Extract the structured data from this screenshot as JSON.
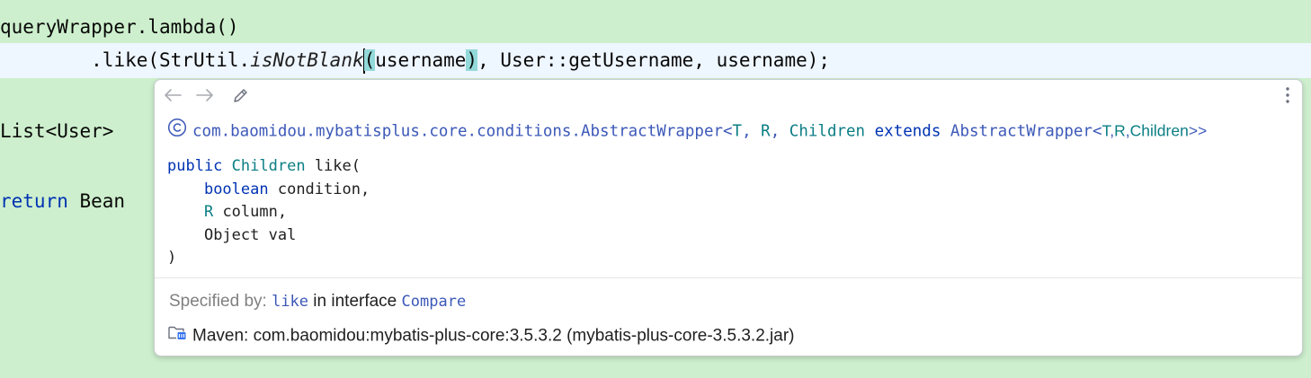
{
  "editor": {
    "line1": "queryWrapper.lambda()",
    "line2": {
      "indent": "        ",
      "like_call": ".like(StrUtil.",
      "method": "isNotBlank",
      "open_paren": "(",
      "arg": "username",
      "close_paren": ")",
      "rest": ", User::getUsername, username);"
    },
    "line3": "List<User>",
    "line4": {
      "keyword": "return",
      "rest": " Bean"
    }
  },
  "popup": {
    "header": {
      "class_path": "com.baomidou.mybatisplus.core.conditions.AbstractWrapper<",
      "t1": "T",
      "sep1": ", ",
      "t2": "R",
      "sep2": ", ",
      "t3": "Children",
      "extends_kw": " extends ",
      "super_class": "AbstractWrapper<",
      "t4": "T",
      "c1": ",",
      "t5": "R",
      "c2": ",",
      "t6": "Children",
      "end": ">>"
    },
    "signature": {
      "mod": "public",
      "ret_type": "Children",
      "name_open": "like(",
      "p1_type": "boolean",
      "p1_name": " condition,",
      "p2_type": "R",
      "p2_name": " column,",
      "p3": "Object val",
      "close": ")"
    },
    "specified": {
      "label": "Specified by: ",
      "method": "like",
      "mid": " in interface ",
      "iface": "Compare"
    },
    "maven": "Maven: com.baomidou:mybatis-plus-core:3.5.3.2 (mybatis-plus-core-3.5.3.2.jar)"
  },
  "colors": {
    "editor_bg": "#cdefcd",
    "keyword": "#0033b3",
    "type_param": "#0b7e85",
    "link": "#3c58b8",
    "brace_highlight": "#93d9d9"
  }
}
